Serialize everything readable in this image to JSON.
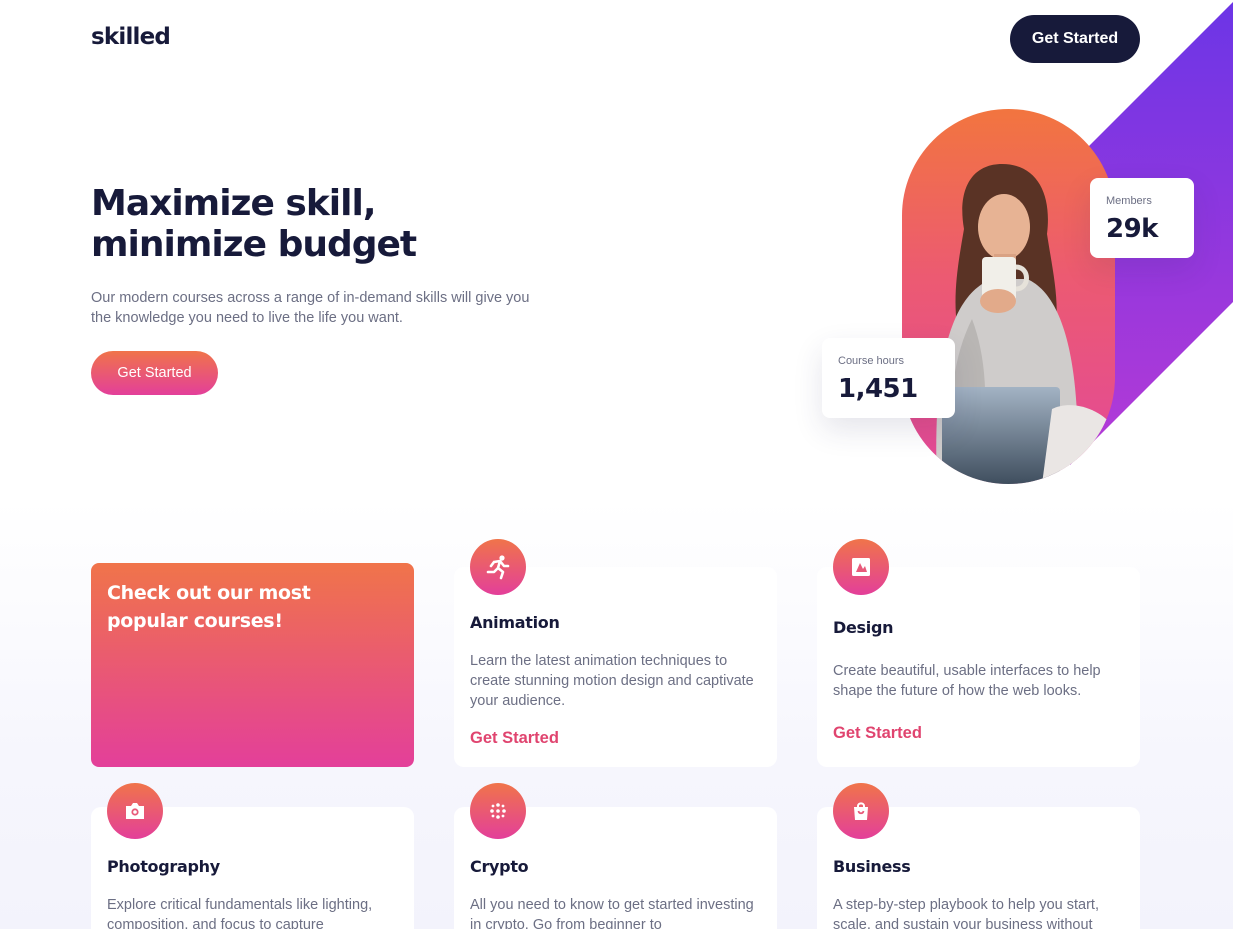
{
  "header": {
    "logo": "skilled",
    "cta_label": "Get Started"
  },
  "hero": {
    "title": "Maximize skill, minimize budget",
    "description": "Our modern courses across a range of in-demand skills will give you the knowledge you need to live the life you want.",
    "cta_label": "Get Started",
    "stats": {
      "members_label": "Members",
      "members_value": "29k",
      "hours_label": "Course hours",
      "hours_value": "1,451"
    }
  },
  "courses": {
    "promo_text": "Check out our most popular courses!",
    "link_label": "Get Started",
    "items": [
      {
        "title": "Animation",
        "description": "Learn the latest animation techniques to create stunning motion design and captivate your audience.",
        "icon": "running-figure-icon"
      },
      {
        "title": "Design",
        "description": "Create beautiful, usable interfaces to help shape the future of how the web looks.",
        "icon": "design-icon"
      },
      {
        "title": "Photography",
        "description": "Explore critical fundamentals like lighting, composition, and focus to capture",
        "icon": "camera-icon"
      },
      {
        "title": "Crypto",
        "description": "All you need to know to get started investing in crypto. Go from beginner to",
        "icon": "crypto-icon"
      },
      {
        "title": "Business",
        "description": "A step-by-step playbook to help you start, scale, and sustain your business without",
        "icon": "shopping-bag-icon"
      }
    ]
  },
  "colors": {
    "navy": "#171a3a",
    "gradient_start": "#f0744a",
    "gradient_end": "#e33f9a",
    "purple": "#6c35e6",
    "link": "#e0446f",
    "muted_text": "#6c6f84"
  }
}
